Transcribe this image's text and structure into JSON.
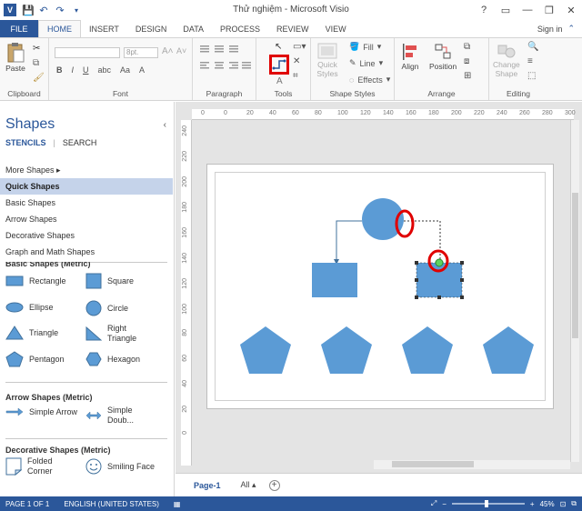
{
  "window": {
    "title": "Thử nghiệm - Microsoft Visio",
    "app_badge": "V",
    "controls": [
      "?",
      "▭",
      "—",
      "❐",
      "✕"
    ]
  },
  "tabs": [
    {
      "label": "FILE"
    },
    {
      "label": "HOME"
    },
    {
      "label": "INSERT"
    },
    {
      "label": "DESIGN"
    },
    {
      "label": "DATA"
    },
    {
      "label": "PROCESS"
    },
    {
      "label": "REVIEW"
    },
    {
      "label": "VIEW"
    }
  ],
  "signin_label": "Sign in",
  "ribbon": {
    "clipboard": {
      "label": "Clipboard",
      "paste": "Paste"
    },
    "font": {
      "label": "Font",
      "font_size": "8pt."
    },
    "paragraph": {
      "label": "Paragraph"
    },
    "tools": {
      "label": "Tools"
    },
    "shape_styles": {
      "label": "Shape Styles",
      "quick_styles_1": "Quick",
      "quick_styles_2": "Styles",
      "fill": "Fill",
      "line": "Line",
      "effects": "Effects"
    },
    "arrange": {
      "label": "Arrange",
      "align": "Align",
      "position": "Position"
    },
    "editing": {
      "label": "Editing",
      "change_shape_1": "Change",
      "change_shape_2": "Shape"
    }
  },
  "shapes_pane": {
    "title": "Shapes",
    "tab_stencils": "STENCILS",
    "tab_search": "SEARCH",
    "stencils": [
      "More Shapes",
      "Quick Shapes",
      "Basic Shapes",
      "Arrow Shapes",
      "Decorative Shapes",
      "Graph and Math Shapes"
    ],
    "selected_stencil": "Quick Shapes",
    "basic_title": "Basic Shapes (Metric)",
    "basic_shapes": [
      "Rectangle",
      "Square",
      "Ellipse",
      "Circle",
      "Triangle",
      "Right Triangle",
      "Pentagon",
      "Hexagon"
    ],
    "arrow_title": "Arrow Shapes (Metric)",
    "arrow_shapes": [
      "Simple Arrow",
      "Simple Doub..."
    ],
    "decor_title": "Decorative Shapes (Metric)",
    "decor_shapes": [
      "Folded Corner",
      "Smiling Face"
    ]
  },
  "ruler": {
    "h_ticks": [
      "0",
      "0",
      "20",
      "40",
      "60",
      "80",
      "100",
      "120",
      "140",
      "160",
      "180",
      "200",
      "220",
      "240",
      "260",
      "280",
      "300"
    ],
    "v_ticks": [
      "240",
      "220",
      "200",
      "180",
      "160",
      "140",
      "120",
      "100",
      "80",
      "60",
      "40",
      "20",
      "0"
    ]
  },
  "page_tabs": {
    "page": "Page-1",
    "all": "All"
  },
  "status": {
    "page": "PAGE 1 OF 1",
    "language": "ENGLISH (UNITED STATES)",
    "zoom": "45%"
  },
  "colors": {
    "accent": "#2b579a",
    "shape_fill": "#5b9bd5",
    "annotation": "#e00000"
  }
}
